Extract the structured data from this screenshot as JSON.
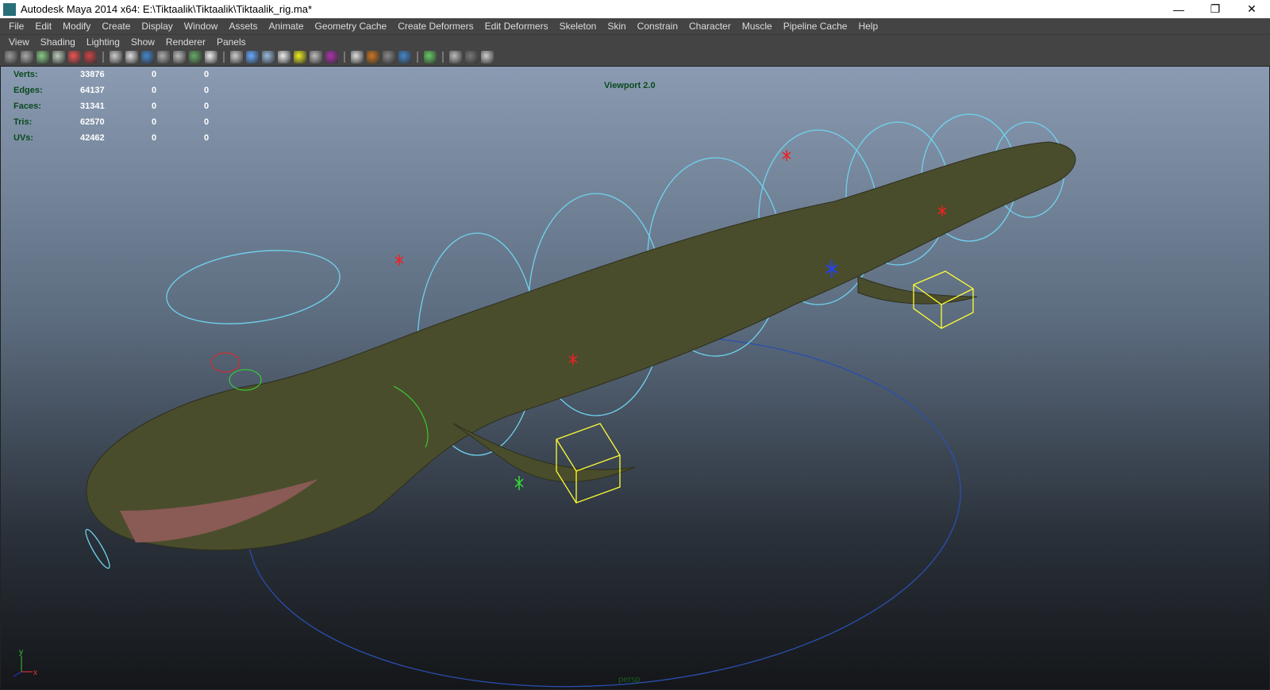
{
  "window": {
    "title": "Autodesk Maya 2014 x64: E:\\Tiktaalik\\Tiktaalik\\Tiktaalik_rig.ma*",
    "minimize": "—",
    "maximize": "❐",
    "close": "✕"
  },
  "menubar": [
    "File",
    "Edit",
    "Modify",
    "Create",
    "Display",
    "Window",
    "Assets",
    "Animate",
    "Geometry Cache",
    "Create Deformers",
    "Edit Deformers",
    "Skeleton",
    "Skin",
    "Constrain",
    "Character",
    "Muscle",
    "Pipeline Cache",
    "Help"
  ],
  "panel_menu": [
    "View",
    "Shading",
    "Lighting",
    "Show",
    "Renderer",
    "Panels"
  ],
  "hud": {
    "rows": [
      {
        "label": "Verts:",
        "value": "33876",
        "sel": "0",
        "comp": "0"
      },
      {
        "label": "Edges:",
        "value": "64137",
        "sel": "0",
        "comp": "0"
      },
      {
        "label": "Faces:",
        "value": "31341",
        "sel": "0",
        "comp": "0"
      },
      {
        "label": "Tris:",
        "value": "62570",
        "sel": "0",
        "comp": "0"
      },
      {
        "label": "UVs:",
        "value": "42462",
        "sel": "0",
        "comp": "0"
      }
    ]
  },
  "viewport_label": "Viewport 2.0",
  "camera_label": "persp",
  "axis": {
    "y": "y",
    "x": "x"
  }
}
